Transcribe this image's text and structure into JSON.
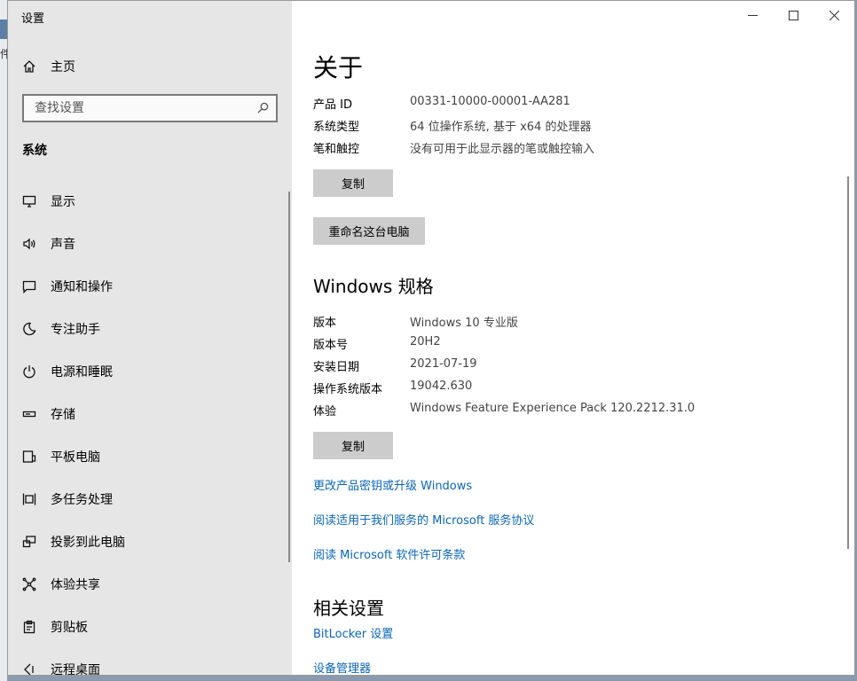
{
  "window": {
    "title": "设置"
  },
  "background": {
    "char": "件"
  },
  "sidebar": {
    "home_label": "主页",
    "search_placeholder": "查找设置",
    "section_title": "系统",
    "items": [
      {
        "label": "显示",
        "icon": "monitor-icon"
      },
      {
        "label": "声音",
        "icon": "speaker-icon"
      },
      {
        "label": "通知和操作",
        "icon": "notification-icon"
      },
      {
        "label": "专注助手",
        "icon": "moon-icon"
      },
      {
        "label": "电源和睡眠",
        "icon": "power-icon"
      },
      {
        "label": "存储",
        "icon": "storage-icon"
      },
      {
        "label": "平板电脑",
        "icon": "tablet-icon"
      },
      {
        "label": "多任务处理",
        "icon": "multitask-icon"
      },
      {
        "label": "投影到此电脑",
        "icon": "project-icon"
      },
      {
        "label": "体验共享",
        "icon": "share-icon"
      },
      {
        "label": "剪贴板",
        "icon": "clipboard-icon"
      },
      {
        "label": "远程桌面",
        "icon": "remote-icon"
      }
    ]
  },
  "main": {
    "title": "关于",
    "device": [
      {
        "label": "产品 ID",
        "value": "00331-10000-00001-AA281"
      },
      {
        "label": "系统类型",
        "value": "64 位操作系统, 基于 x64 的处理器"
      },
      {
        "label": "笔和触控",
        "value": "没有可用于此显示器的笔或触控输入"
      }
    ],
    "copy_label": "复制",
    "rename_label": "重命名这台电脑",
    "windows_spec_title": "Windows 规格",
    "windows_spec": [
      {
        "label": "版本",
        "value": "Windows 10 专业版"
      },
      {
        "label": "版本号",
        "value": "20H2"
      },
      {
        "label": "安装日期",
        "value": "2021-07-19"
      },
      {
        "label": "操作系统版本",
        "value": "19042.630"
      },
      {
        "label": "体验",
        "value": "Windows Feature Experience Pack 120.2212.31.0"
      }
    ],
    "links": [
      "更改产品密钥或升级 Windows",
      "阅读适用于我们服务的 Microsoft 服务协议",
      "阅读 Microsoft 软件许可条款"
    ],
    "related_title": "相关设置",
    "related_links": [
      "BitLocker 设置",
      "设备管理器"
    ]
  }
}
